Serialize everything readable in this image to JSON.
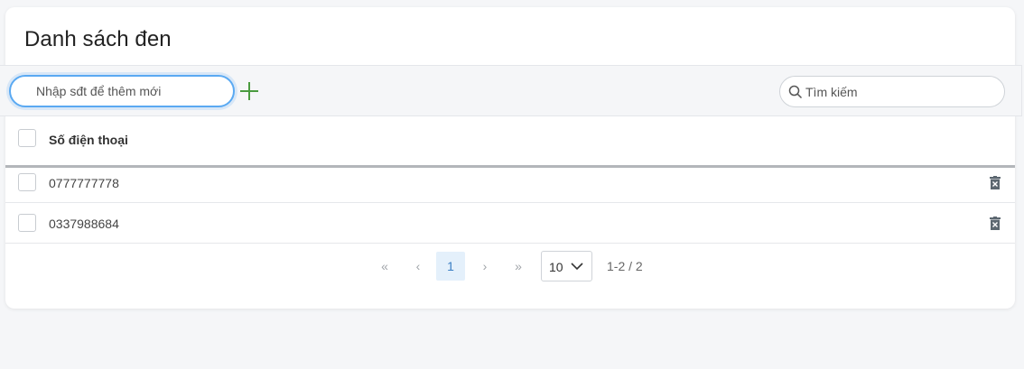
{
  "page": {
    "title": "Danh sách đen"
  },
  "toolbar": {
    "add_placeholder": "Nhập sđt để thêm mới",
    "search_placeholder": "Tìm kiếm"
  },
  "table": {
    "header": "Số điện thoại",
    "rows": [
      {
        "phone": "0777777778"
      },
      {
        "phone": "0337988684"
      }
    ]
  },
  "pagination": {
    "first": "«",
    "prev": "‹",
    "current_page": "1",
    "next": "›",
    "last": "»",
    "page_size": "10",
    "range": "1-2 / 2"
  },
  "colors": {
    "accent": "#5aa9f2",
    "plus": "#4a9b3f",
    "delete_icon": "#5c6770"
  }
}
